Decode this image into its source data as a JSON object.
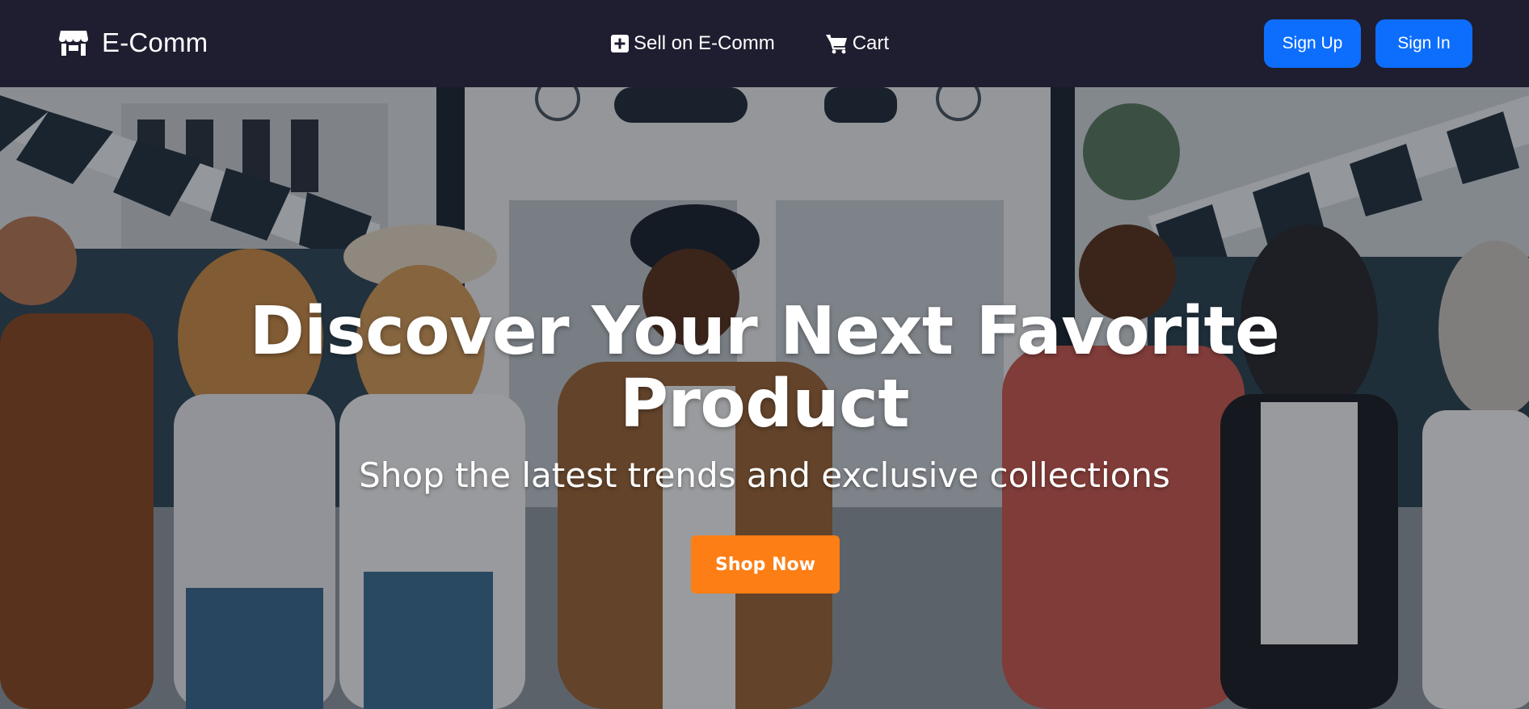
{
  "navbar": {
    "brand": {
      "label": "E-Comm",
      "icon": "store-icon"
    },
    "links": [
      {
        "label": "Sell on E-Comm",
        "icon": "plus-square-icon"
      },
      {
        "label": "Cart",
        "icon": "cart-icon"
      }
    ],
    "buttons": {
      "signup_label": "Sign Up",
      "signin_label": "Sign In"
    }
  },
  "hero": {
    "title_line1": "Discover Your Next Favorite",
    "title_line2": "Product",
    "subtitle": "Shop the latest trends and exclusive collections",
    "cta_label": "Shop Now"
  },
  "colors": {
    "navbar_bg": "#1f1d30",
    "primary_button": "#0d6efd",
    "cta_button": "#fd7e14",
    "text": "#ffffff"
  }
}
